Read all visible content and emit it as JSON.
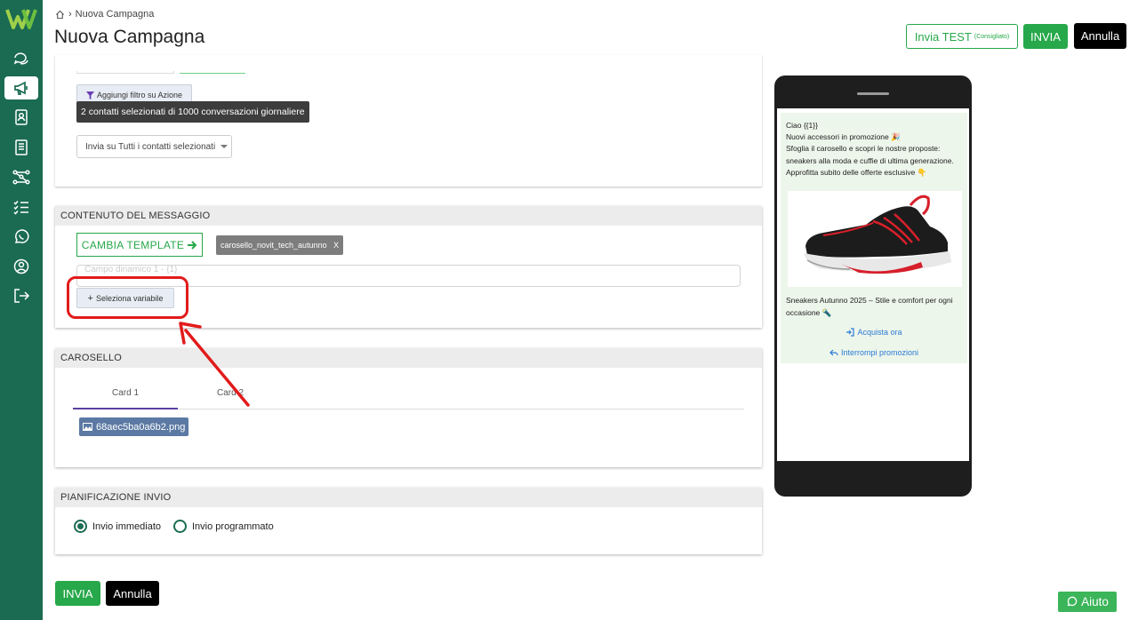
{
  "header": {
    "breadcrumb_current": "Nuova Campagna",
    "title": "Nuova Campagna",
    "test_button": "Invia TEST",
    "test_note": "(Consigliato)",
    "send_button": "INVIA",
    "cancel_button": "Annulla"
  },
  "sidebar": {
    "items": [
      "chat-icon",
      "megaphone-icon",
      "contacts-icon",
      "templates-icon",
      "flows-icon",
      "tasks-icon",
      "whatsapp-icon",
      "user-icon",
      "logout-icon"
    ],
    "active": "megaphone-icon"
  },
  "filters": {
    "add_action_filter": "Aggiungi filtro su Azione",
    "selected_contacts": "2 contatti selezionati di 1000 conversazioni giornaliere",
    "send_to_select": "Invia su Tutti i contatti selezionati"
  },
  "message": {
    "section_title": "CONTENUTO DEL MESSAGGIO",
    "change_template": "CAMBIA TEMPLATE",
    "template_tag": "carosello_novit_tech_autunno",
    "template_tag_close": "X",
    "field_placeholder": "Campo dinamico 1 - {1}",
    "select_variable": "Seleziona variabile"
  },
  "carousel": {
    "section_title": "CAROSELLO",
    "tabs": [
      "Card 1",
      "Card 2"
    ],
    "active_tab": 0,
    "file_name": "68aec5ba0a6b2.png"
  },
  "schedule": {
    "section_title": "PIANIFICAZIONE INVIO",
    "option_immediate": "Invio immediato",
    "option_scheduled": "Invio programmato",
    "selected": "immediate"
  },
  "footer": {
    "send_button": "INVIA",
    "cancel_button": "Annulla"
  },
  "preview": {
    "message": "Ciao {{1}}\nNuovi accessori in promozione 🎉\nSfoglia il carosello e scopri le nostre proposte: sneakers alla moda e cuffie di ultima generazione.\nApprofitta subito delle offerte esclusive 👇",
    "card_caption": "Sneakers Autunno 2025 – Stile e comfort per ogni occasione 🔦",
    "action_buy": "Acquista ora",
    "action_stop": "Interrompi promozioni"
  },
  "help_button": "Aiuto",
  "colors": {
    "brand_green": "#1b6b52",
    "accent_green": "#27a84a",
    "annotation_red": "#e21b1b"
  }
}
